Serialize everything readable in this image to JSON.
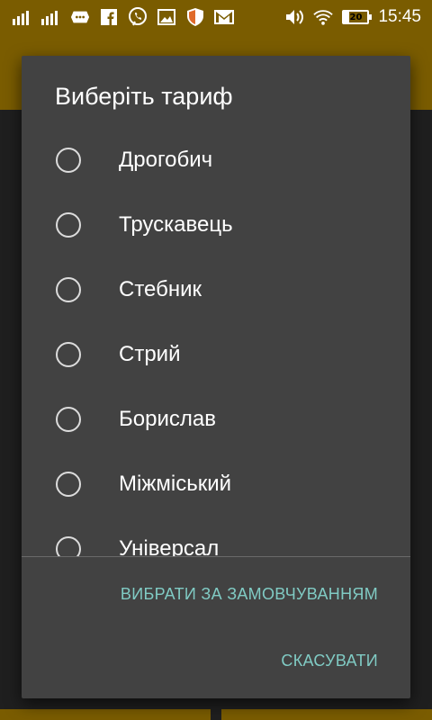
{
  "status_bar": {
    "battery_level": "20",
    "battery_fraction": 0.2,
    "time": "15:45"
  },
  "dialog": {
    "title": "Виберіть тариф",
    "options": [
      {
        "label": "Дрогобич",
        "selected": false
      },
      {
        "label": "Трускавець",
        "selected": false
      },
      {
        "label": "Стебник",
        "selected": false
      },
      {
        "label": "Стрий",
        "selected": false
      },
      {
        "label": "Борислав",
        "selected": false
      },
      {
        "label": "Міжміський",
        "selected": false
      },
      {
        "label": "Універсал",
        "selected": false
      }
    ],
    "default_button": "ВИБРАТИ ЗА ЗАМОВЧУВАННЯМ",
    "cancel_button": "СКАСУВАТИ"
  },
  "colors": {
    "accent": "#80cbc4",
    "app_bar": "#7a5c00",
    "dialog_bg": "#424242"
  }
}
